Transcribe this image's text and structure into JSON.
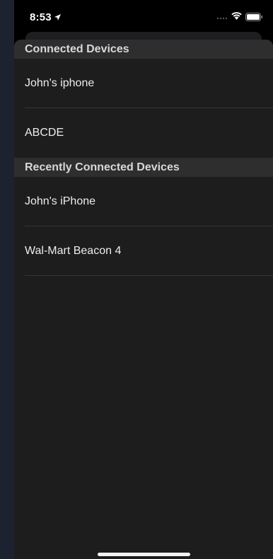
{
  "status_bar": {
    "time": "8:53",
    "icons": [
      "location-arrow-icon",
      "cellular-signal-icon",
      "wifi-icon",
      "battery-icon"
    ]
  },
  "sections": [
    {
      "header": "Connected Devices",
      "devices": [
        "John's iphone",
        "ABCDE"
      ]
    },
    {
      "header": "Recently Connected Devices",
      "devices": [
        "John's iPhone",
        "Wal-Mart Beacon 4"
      ]
    }
  ],
  "colors": {
    "background": "#000000",
    "sheet": "#1d1d1d",
    "section_header_bg": "#2e2e2e",
    "text": "#ededed"
  }
}
